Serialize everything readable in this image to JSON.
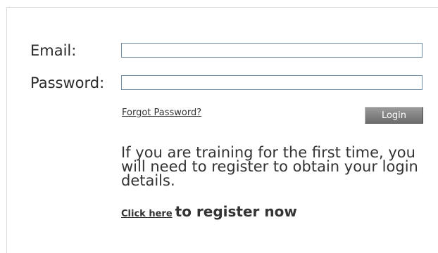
{
  "login_form": {
    "email_label": "Email:",
    "email_value": "",
    "password_label": "Password:",
    "password_value": "",
    "forgot_password_link": "Forgot Password?",
    "login_button": "Login"
  },
  "registration": {
    "message": "If you are training for the first time, you will need to register to obtain your login details.",
    "click_here_link": "Click here",
    "register_suffix": "to register now"
  },
  "colors": {
    "input_border": "#6f8ea6",
    "button_background": "#7f7f7f",
    "text": "#333333"
  }
}
